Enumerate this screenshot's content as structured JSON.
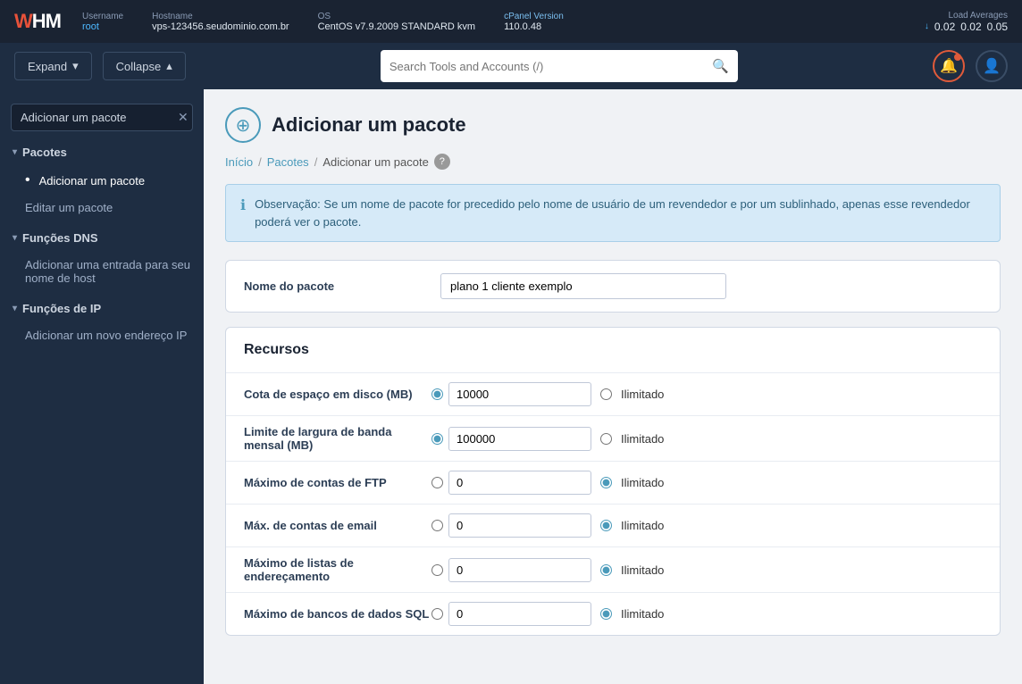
{
  "topbar": {
    "logo": "WHM",
    "username_label": "Username",
    "username_value": "root",
    "hostname_label": "Hostname",
    "hostname_value": "vps-123456.seudominio.com.br",
    "os_label": "OS",
    "os_value": "CentOS v7.9.2009 STANDARD kvm",
    "cpanel_label": "cPanel Version",
    "cpanel_value": "110.0.48",
    "load_label": "Load Averages",
    "load_icon": "↓",
    "load_values": [
      "0.02",
      "0.02",
      "0.05"
    ]
  },
  "secondbar": {
    "expand_label": "Expand",
    "collapse_label": "Collapse",
    "search_placeholder": "Search Tools and Accounts (/)"
  },
  "sidebar": {
    "search_value": "Adicionar um pacote",
    "sections": [
      {
        "label": "Pacotes",
        "items": [
          {
            "label": "Adicionar um pacote",
            "active": true
          },
          {
            "label": "Editar um pacote",
            "active": false
          }
        ]
      },
      {
        "label": "Funções DNS",
        "items": [
          {
            "label": "Adicionar uma entrada para seu nome de host",
            "active": false
          }
        ]
      },
      {
        "label": "Funções de IP",
        "items": [
          {
            "label": "Adicionar um novo endereço IP",
            "active": false
          }
        ]
      }
    ]
  },
  "page": {
    "title": "Adicionar um pacote",
    "breadcrumb": {
      "inicio": "Início",
      "pacotes": "Pacotes",
      "current": "Adicionar um pacote"
    },
    "notice": "Observação: Se um nome de pacote for precedido pelo nome de usuário de um revendedor e por um sublinhado, apenas esse revendedor poderá ver o pacote.",
    "package_name_label": "Nome do pacote",
    "package_name_value": "plano 1 cliente exemplo",
    "resources_title": "Recursos",
    "resources": [
      {
        "label": "Cota de espaço em disco (MB)",
        "radio_value": "specific",
        "input_value": "10000",
        "unlimited": false,
        "unlimited_label": "Ilimitado"
      },
      {
        "label": "Limite de largura de banda mensal (MB)",
        "radio_value": "specific",
        "input_value": "100000",
        "unlimited": false,
        "unlimited_label": "Ilimitado"
      },
      {
        "label": "Máximo de contas de FTP",
        "radio_value": "unlimited",
        "input_value": "0",
        "unlimited": true,
        "unlimited_label": "Ilimitado"
      },
      {
        "label": "Máx. de contas de email",
        "radio_value": "unlimited",
        "input_value": "0",
        "unlimited": true,
        "unlimited_label": "Ilimitado"
      },
      {
        "label": "Máximo de listas de endereçamento",
        "radio_value": "unlimited",
        "input_value": "0",
        "unlimited": true,
        "unlimited_label": "Ilimitado"
      },
      {
        "label": "Máximo de bancos de dados SQL",
        "radio_value": "unlimited",
        "input_value": "0",
        "unlimited": true,
        "unlimited_label": "Ilimitado"
      }
    ]
  }
}
